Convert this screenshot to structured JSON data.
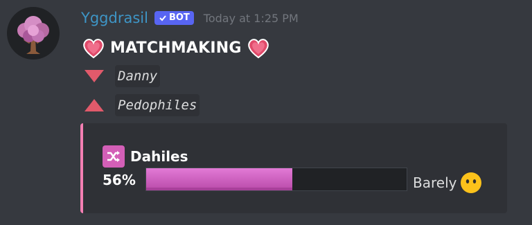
{
  "header": {
    "username": "Yggdrasil",
    "bot_label": "BOT",
    "timestamp": "Today at 1:25 PM"
  },
  "message": {
    "title": "MATCHMAKING",
    "title_icon": "heart-emoji",
    "lines": [
      {
        "icon": "down-triangle-icon",
        "text": "Danny",
        "color": "#e15a6b"
      },
      {
        "icon": "up-triangle-icon",
        "text": "Pedophiles",
        "color": "#e15a6b"
      }
    ]
  },
  "embed": {
    "accent_color": "#f47fb3",
    "title": "Dahiles",
    "title_icon": "shuffle-icon",
    "percent_label": "56%",
    "progress": 0.56,
    "verdict": "Barely",
    "verdict_icon": "neutral-face-emoji"
  }
}
